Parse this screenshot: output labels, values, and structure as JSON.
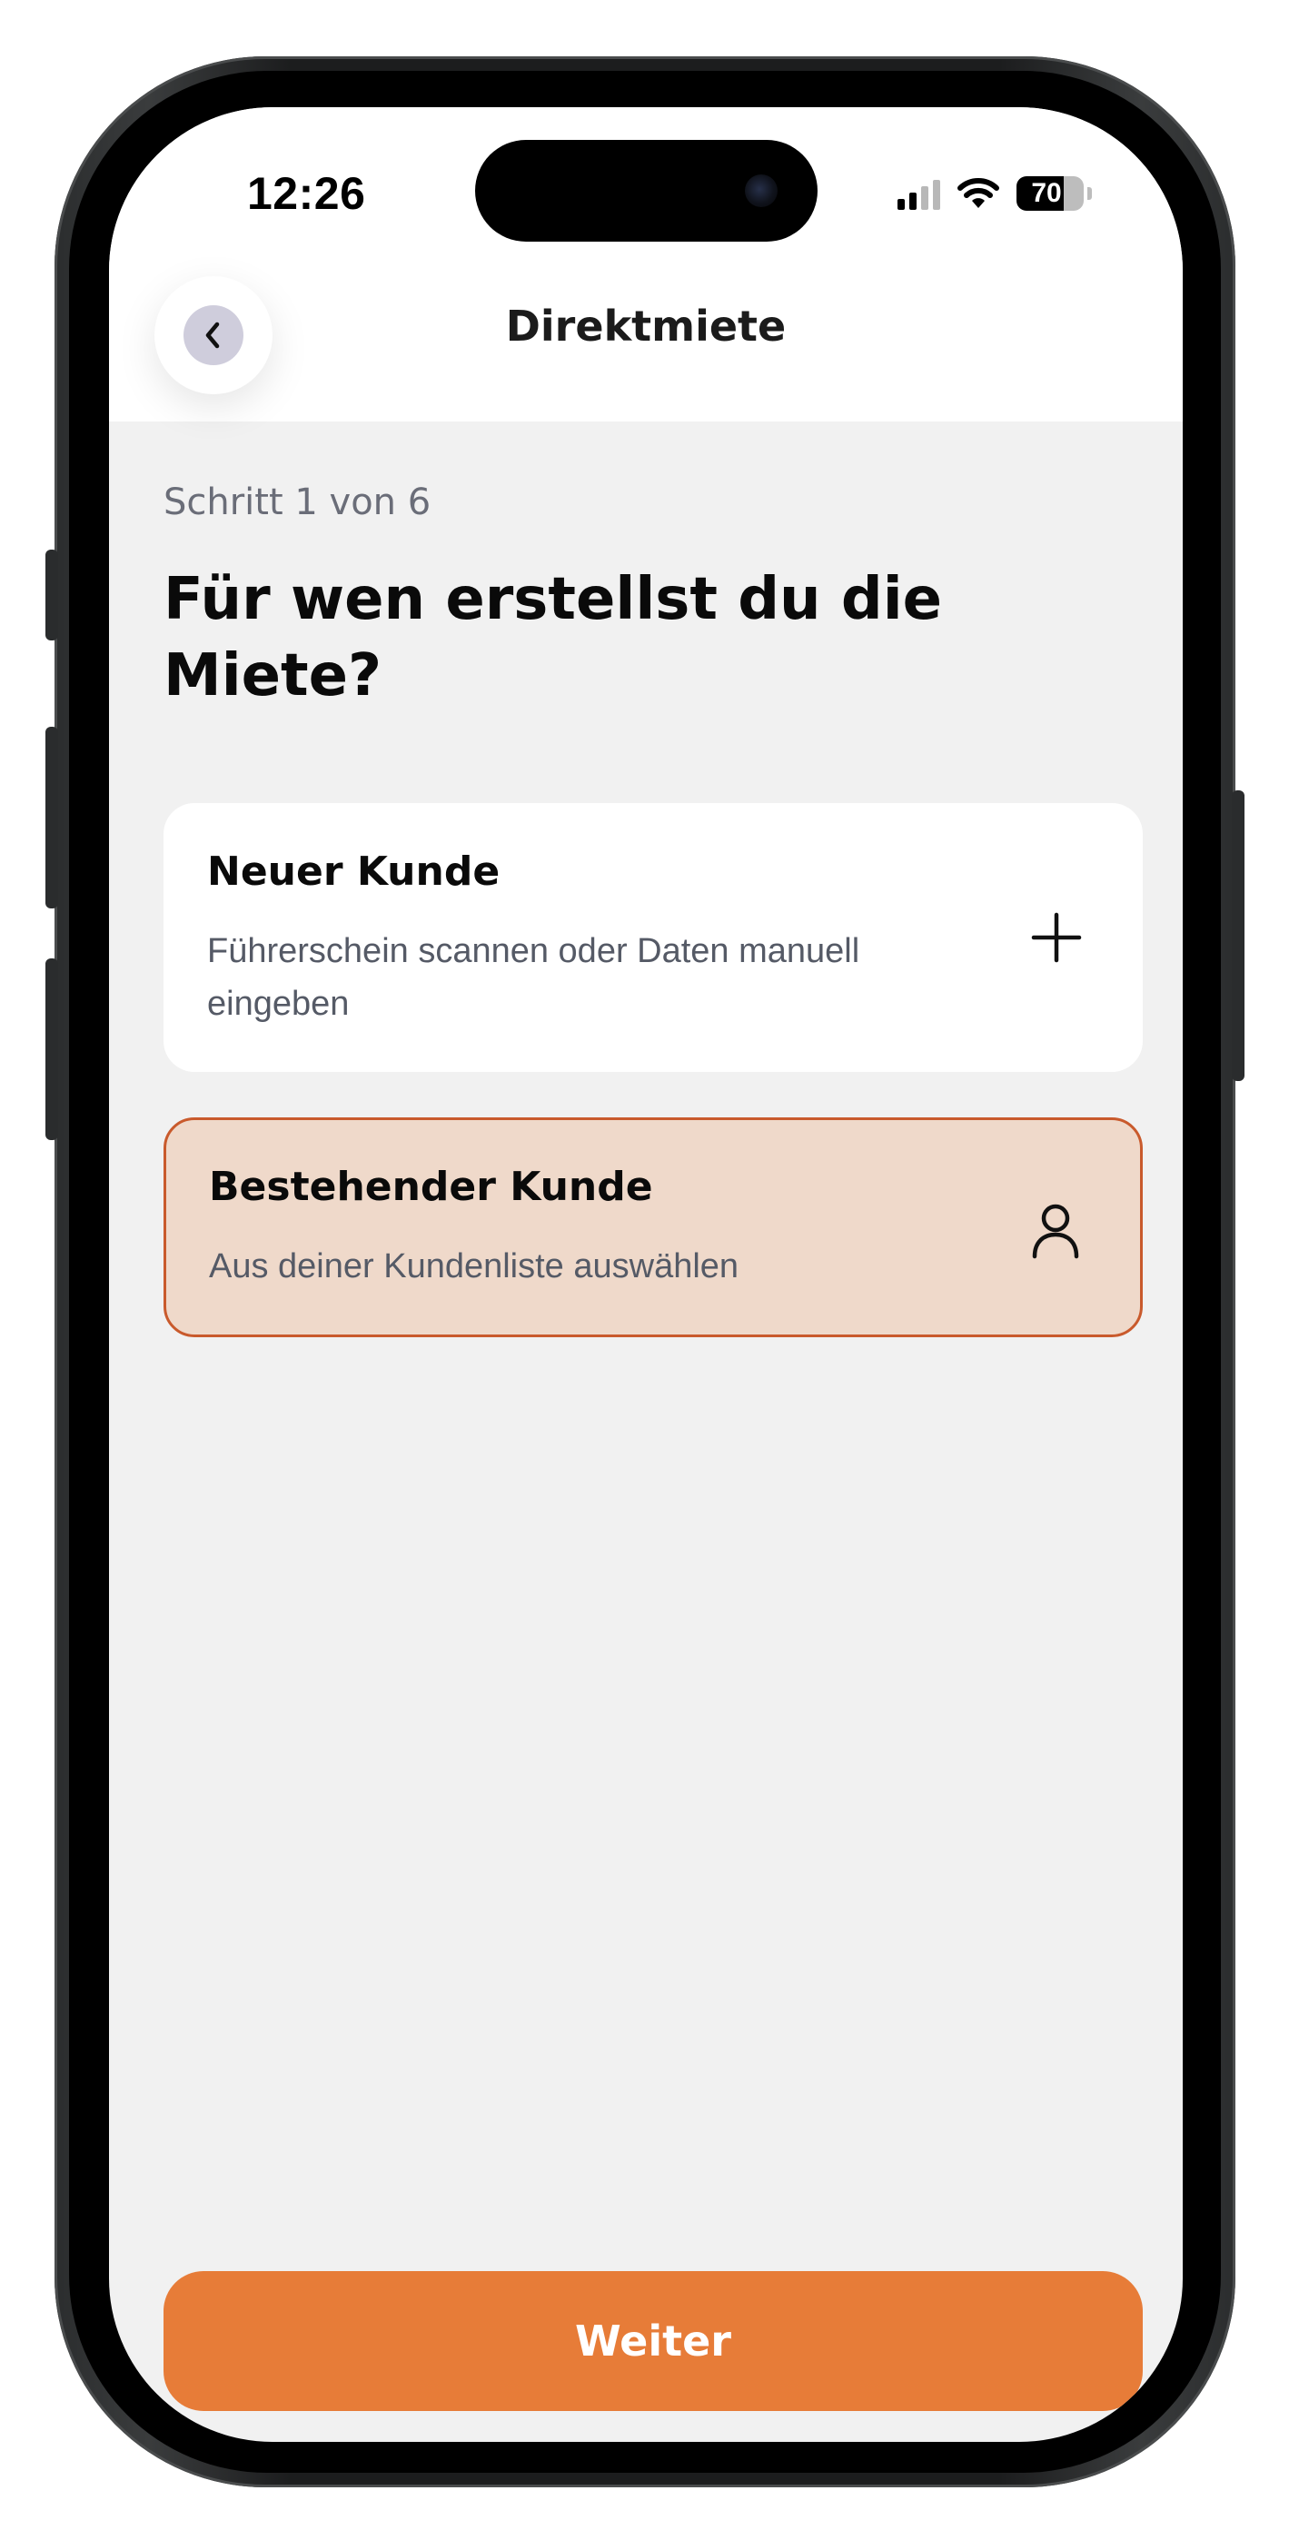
{
  "status_bar": {
    "time": "12:26",
    "battery_level": "70",
    "icons": [
      "signal-icon",
      "wifi-icon",
      "battery-icon"
    ]
  },
  "header": {
    "title": "Direktmiete",
    "back_icon": "chevron-left-icon"
  },
  "step": {
    "label": "Schritt 1 von 6"
  },
  "question": "Für wen erstellst du die Miete?",
  "options": [
    {
      "title": "Neuer Kunde",
      "description": "Führerschein scannen oder Daten manuell eingeben",
      "icon": "plus-icon",
      "selected": false
    },
    {
      "title": "Bestehender Kunde",
      "description": "Aus deiner Kundenliste auswählen",
      "icon": "user-icon",
      "selected": true
    }
  ],
  "footer": {
    "continue_label": "Weiter"
  },
  "colors": {
    "accent": "#e77c38",
    "selected_border": "#c95a2c",
    "selected_background": "#efd9ca",
    "page_background": "#f1f1f1",
    "back_button": "#cfcddc"
  }
}
